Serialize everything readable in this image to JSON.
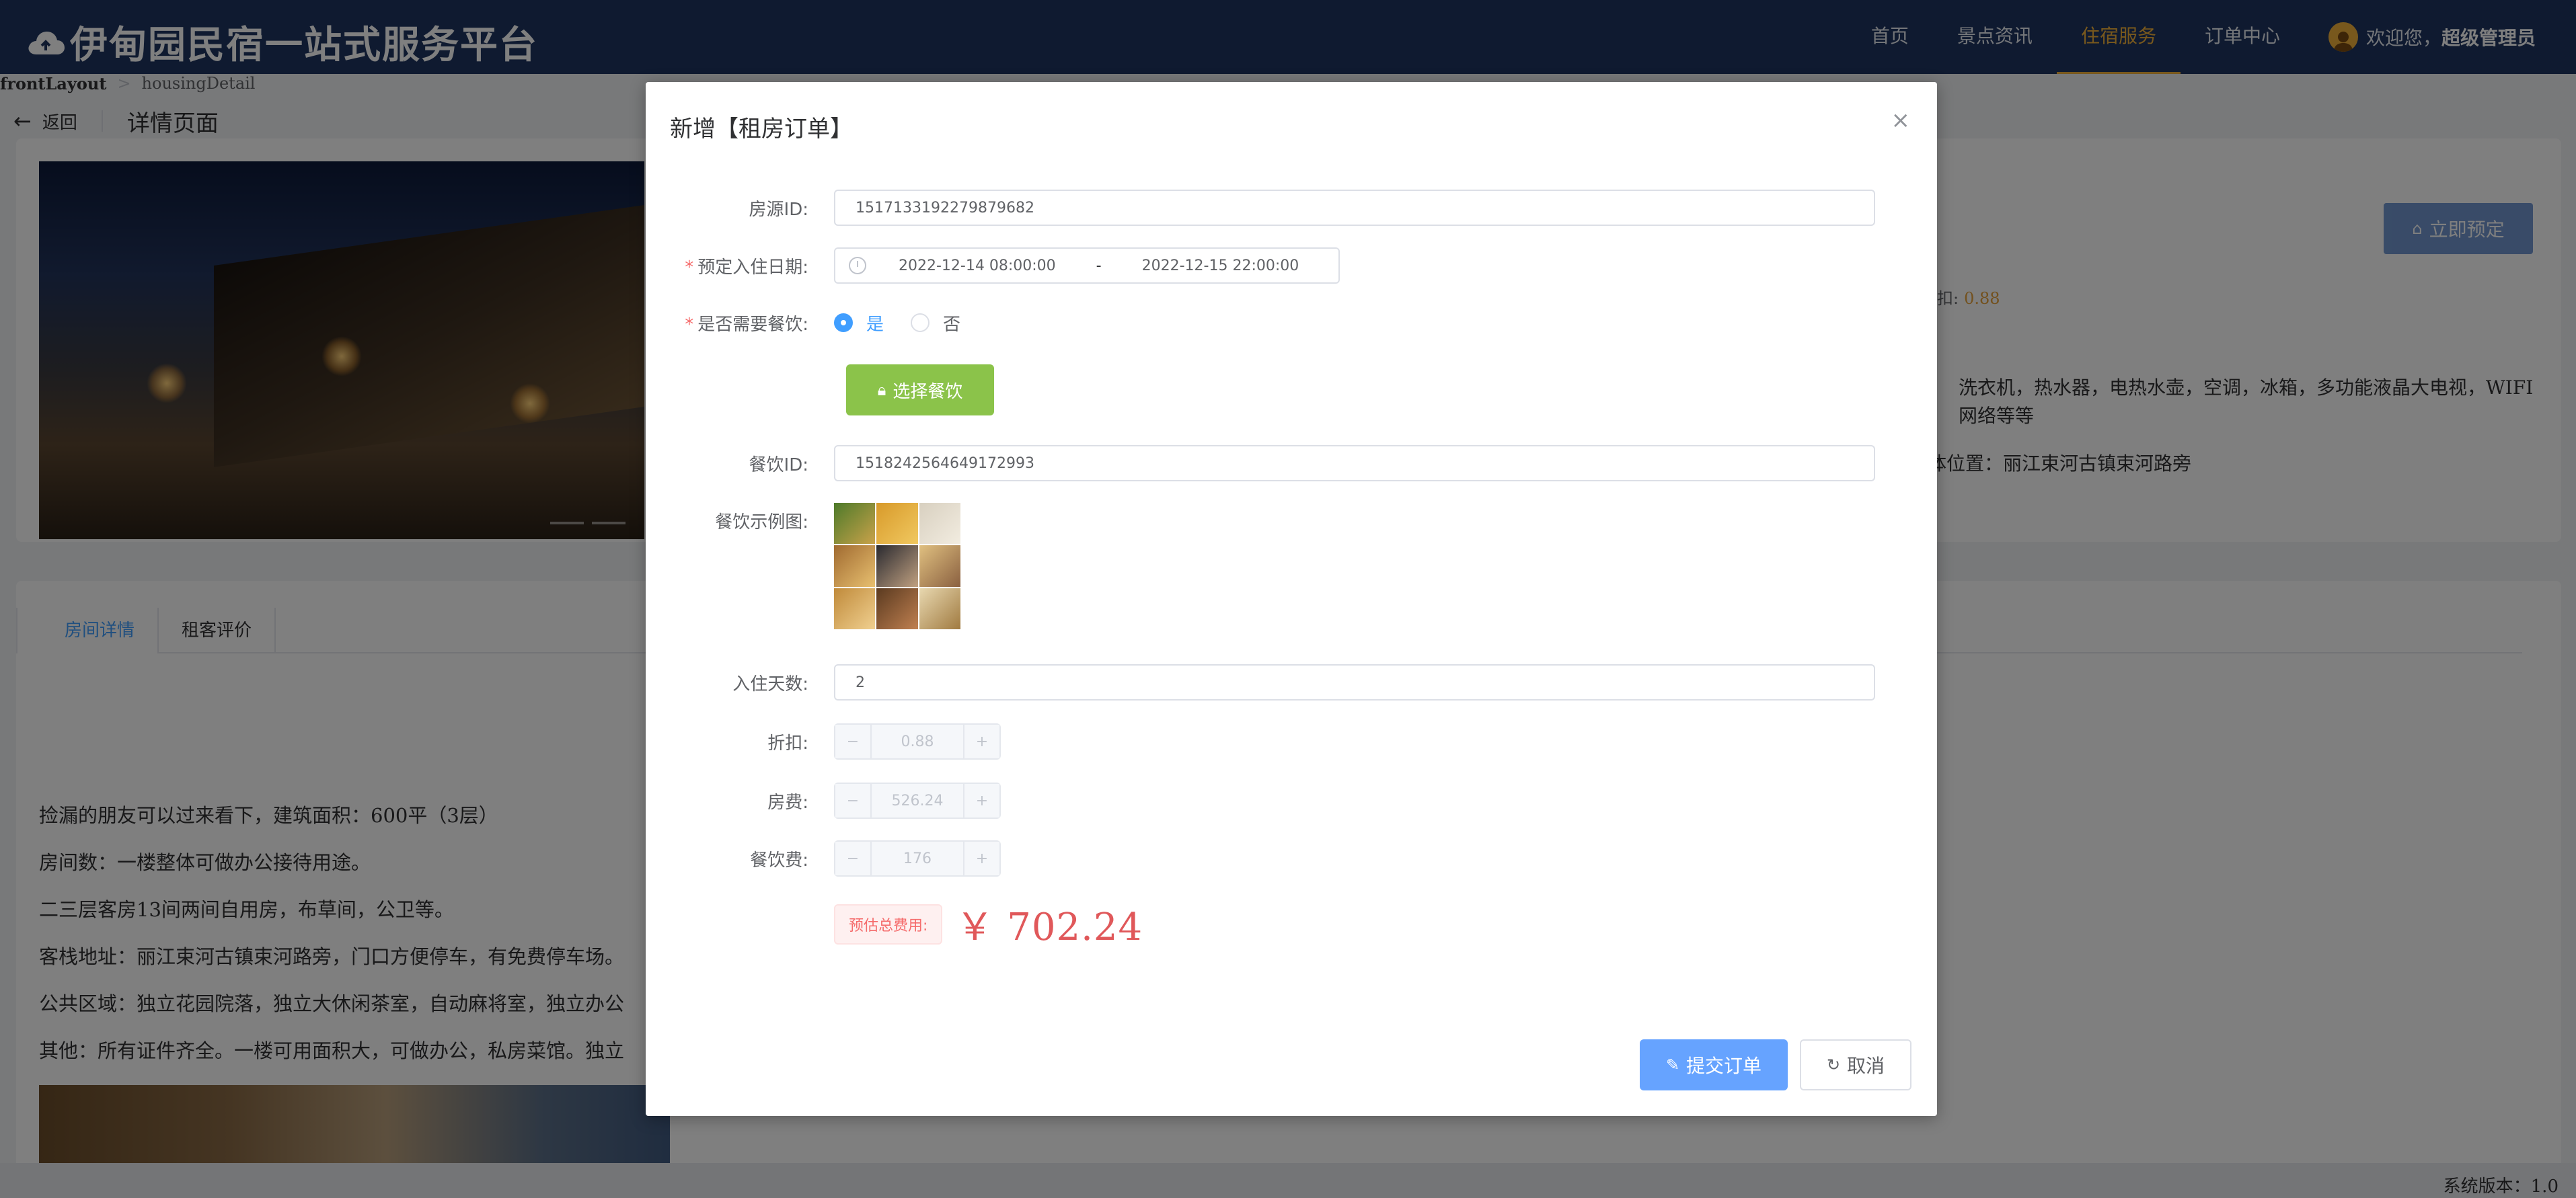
{
  "app": {
    "title": "伊甸园民宿一站式服务平台"
  },
  "nav": {
    "items": [
      "首页",
      "景点资讯",
      "住宿服务",
      "订单中心"
    ],
    "active_index": 2,
    "welcome": "欢迎您，",
    "username": "超级管理员"
  },
  "breadcrumb": [
    "frontLayout",
    "housingDetail"
  ],
  "page_header": {
    "back_label": "返回",
    "title": "详情页面"
  },
  "background": {
    "book_button": "立即预定",
    "discount_label": "扣:",
    "discount_value": "0.88",
    "facilities": "洗衣机，热水器，电热水壶，空调，冰箱，多功能液晶大电视，WIFI网络等等",
    "location": "体位置：丽江束河古镇束河路旁",
    "tabs": [
      "房间详情",
      "租客评价"
    ],
    "description": [
      "捡漏的朋友可以过来看下，建筑面积：600平（3层）",
      "房间数：一楼整体可做办公接待用途。",
      "二三层客房13间两间自用房，布草间，公卫等。",
      "客栈地址：丽江束河古镇束河路旁，门口方便停车，有免费停车场。",
      "公共区域：独立花园院落，独立大休闲茶室，自动麻将室，独立办公",
      "其他：所有证件齐全。一楼可用面积大，可做办公，私房菜馆。独立"
    ],
    "version": "系统版本：1.0"
  },
  "dialog": {
    "title": "新增【租房订单】",
    "fields": {
      "housing_id": {
        "label": "房源ID:",
        "value": "1517133192279879682"
      },
      "checkin_date": {
        "label": "预定入住日期:",
        "start": "2022-12-14 08:00:00",
        "separator": "-",
        "end": "2022-12-15 22:00:00"
      },
      "need_meal": {
        "label": "是否需要餐饮:",
        "options": [
          "是",
          "否"
        ],
        "selected": "是"
      },
      "select_meal_button": "选择餐饮",
      "meal_id": {
        "label": "餐饮ID:",
        "value": "1518242564649172993"
      },
      "meal_image": {
        "label": "餐饮示例图:"
      },
      "days": {
        "label": "入住天数:",
        "value": "2"
      },
      "discount": {
        "label": "折扣:",
        "value": "0.88"
      },
      "room_fee": {
        "label": "房费:",
        "value": "526.24"
      },
      "meal_fee": {
        "label": "餐饮费:",
        "value": "176"
      },
      "total": {
        "label": "预估总费用:",
        "value": "￥ 702.24"
      }
    },
    "submit_button": "提交订单",
    "cancel_button": "取消",
    "close_icon": "×"
  },
  "colors": {
    "header_bg": "#1e3560",
    "nav_active": "#f0b13a",
    "primary": "#409eff",
    "green": "#8bc34a",
    "danger": "#e0585a"
  }
}
